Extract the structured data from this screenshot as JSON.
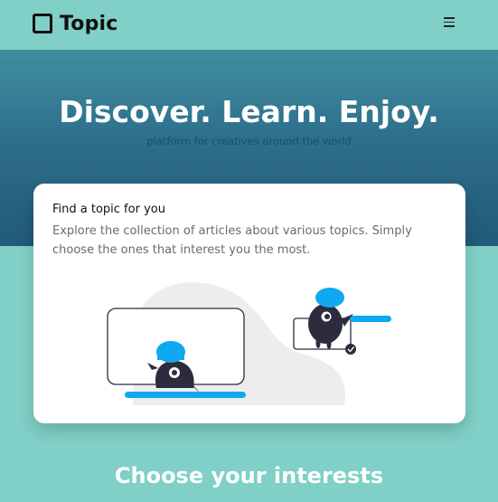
{
  "navbar": {
    "brand": "Topic",
    "logo_icon": "squares-logo-icon",
    "menu_icon": "hamburger-icon"
  },
  "hero": {
    "title": "Discover. Learn. Enjoy.",
    "subtitle": "platform for creatives around the world"
  },
  "card": {
    "title": "Find a topic for you",
    "description": "Explore the collection of articles about various topics. Simply choose the ones that interest you the most.",
    "illustration": "topic-characters-illustration"
  },
  "section": {
    "title": "Choose your interests"
  },
  "colors": {
    "background": "#80d0c7",
    "hero_gradient_top": "#3f8ea0",
    "hero_gradient_bottom": "#215a7a",
    "accent_blue": "#10a8f0",
    "dark": "#2d2c3e"
  }
}
